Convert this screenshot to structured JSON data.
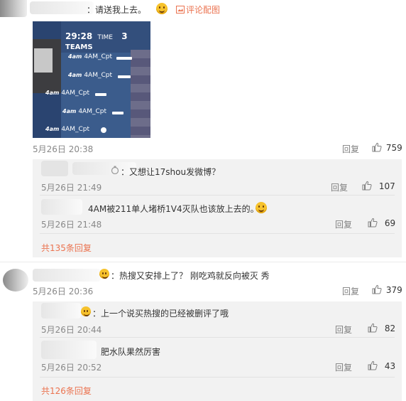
{
  "comment1": {
    "text": "：请送我上去。",
    "image_link": "评论配图",
    "image": {
      "timer": "29:28",
      "time_label": "TIME",
      "teams_count": "3",
      "teams_label": "TEAMS",
      "rows": [
        {
          "logo": "4am",
          "name": "4AM_Cpt"
        },
        {
          "logo": "4am",
          "name": "4AM_Cpt"
        },
        {
          "logo": "4am",
          "name": "4AM_Cpt"
        },
        {
          "logo": "4am",
          "name": "4AM_Cpt"
        },
        {
          "logo": "4am",
          "name": "4AM_Cpt"
        }
      ]
    },
    "time": "5月26日 20:38",
    "reply_label": "回复",
    "likes": "759",
    "replies": [
      {
        "text": "：又想让17shou发微博？",
        "time": "5月26日 21:49",
        "reply_label": "回复",
        "likes": "107"
      },
      {
        "text": "4AM被211单人堵桥1V4灭队也该放上去的。",
        "time": "5月26日 21:48",
        "reply_label": "回复",
        "likes": "69"
      }
    ],
    "total_replies": "共135条回复"
  },
  "comment2": {
    "text": "：热搜又安排上了？ 刚吃鸡就反向被灭 秀",
    "time": "5月26日 20:36",
    "reply_label": "回复",
    "likes": "379",
    "replies": [
      {
        "text": "：上一个说买热搜的已经被删评了哦",
        "time": "5月26日 20:44",
        "reply_label": "回复",
        "likes": "82"
      },
      {
        "text": "肥水队果然厉害",
        "time": "5月26日 20:52",
        "reply_label": "回复",
        "likes": "43"
      }
    ],
    "total_replies": "共126条回复"
  },
  "colors": {
    "link": "#eb7350",
    "meta": "#888888",
    "reply_bg": "#f2f2f2"
  }
}
